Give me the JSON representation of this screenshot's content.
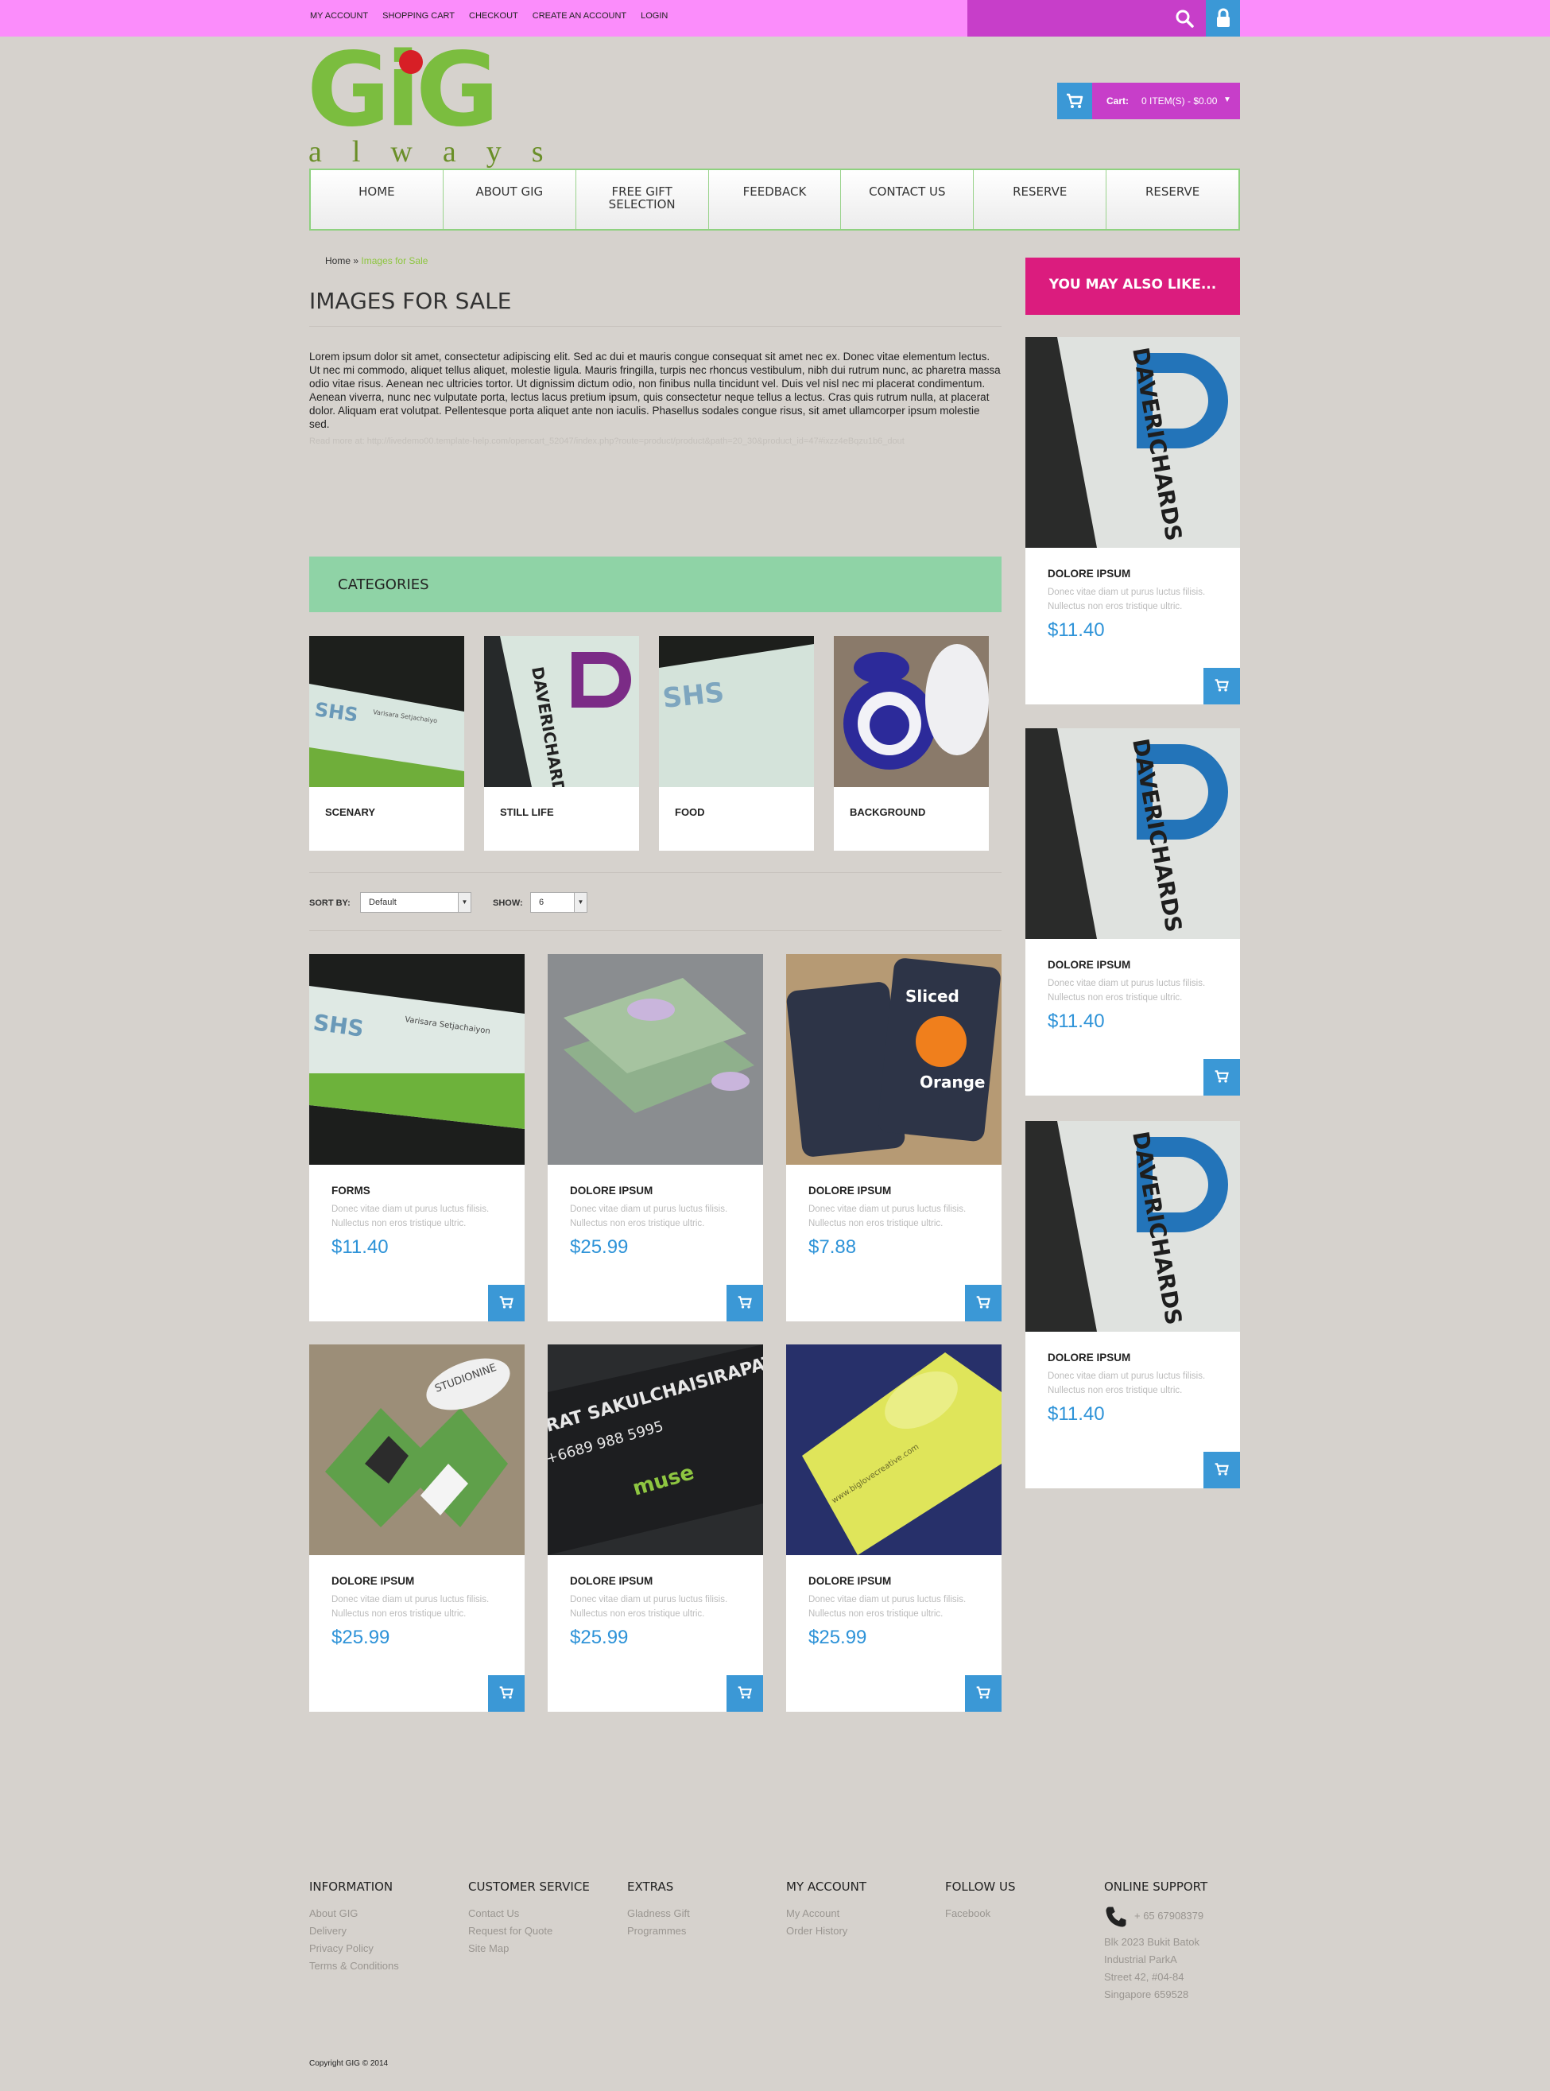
{
  "topbar": {
    "links": [
      "MY ACCOUNT",
      "SHOPPING CART",
      "CHECKOUT",
      "CREATE AN ACCOUNT",
      "LOGIN"
    ]
  },
  "logo": {
    "main": "GiG",
    "sub": "always"
  },
  "cart": {
    "label": "Cart:",
    "value": "0 ITEM(S) - $0.00"
  },
  "nav": [
    "HOME",
    "ABOUT GIG",
    "FREE GIFT SELECTION",
    "FEEDBACK",
    "CONTACT US",
    "RESERVE",
    "RESERVE"
  ],
  "breadcrumb": {
    "home": "Home",
    "sep": "»",
    "current": "Images for Sale"
  },
  "page": {
    "title": "IMAGES FOR SALE",
    "description": "Lorem ipsum dolor sit amet, consectetur adipiscing elit. Sed ac dui et mauris congue consequat sit amet nec ex. Donec vitae elementum lectus. Ut nec mi commodo, aliquet tellus aliquet, molestie ligula. Mauris fringilla, turpis nec rhoncus vestibulum, nibh dui rutrum nunc, ac pharetra massa odio vitae risus. Aenean nec ultricies tortor. Ut dignissim dictum odio, non finibus nulla tincidunt vel. Duis vel nisl nec mi placerat condimentum. Aenean viverra, nunc nec vulputate porta, lectus lacus pretium ipsum, quis consectetur neque tellus a lectus. Cras quis rutrum nulla, at placerat dolor. Aliquam erat volutpat. Pellentesque porta aliquet ante non iaculis. Phasellus sodales congue risus, sit amet ullamcorper ipsum molestie sed.",
    "faint": "Read more at: http://livedemo00.template-help.com/opencart_52047/index.php?route=product/product&path=20_30&product_id=47#ixzz4eBqzu1b6_dout"
  },
  "categories": {
    "heading": "CATEGORIES",
    "items": [
      {
        "name": "SCENARY",
        "image": "shs-card"
      },
      {
        "name": "STILL LIFE",
        "image": "daverichards-card"
      },
      {
        "name": "FOOD",
        "image": "shs-card-plain"
      },
      {
        "name": "BACKGROUND",
        "image": "sticker-card"
      }
    ]
  },
  "sort": {
    "sort_label": "SORT BY:",
    "sort_value": "Default",
    "show_label": "SHOW:",
    "show_value": "6"
  },
  "products": [
    {
      "name": "FORMS",
      "desc": "Donec vitae diam ut purus luctus filisis. Nullectus non eros tristique ultric.",
      "price": "$11.40",
      "image": "shs-green"
    },
    {
      "name": "DOLORE IPSUM",
      "desc": "Donec vitae diam ut purus luctus filisis. Nullectus non eros tristique ultric.",
      "price": "$25.99",
      "image": "pretty-green"
    },
    {
      "name": "DOLORE IPSUM",
      "desc": "Donec vitae diam ut purus luctus filisis. Nullectus non eros tristique ultric.",
      "price": "$7.88",
      "image": "sliced-orange"
    },
    {
      "name": "DOLORE IPSUM",
      "desc": "Donec vitae diam ut purus luctus filisis. Nullectus non eros tristique ultric.",
      "price": "$25.99",
      "image": "studionine"
    },
    {
      "name": "DOLORE IPSUM",
      "desc": "Donec vitae diam ut purus luctus filisis. Nullectus non eros tristique ultric.",
      "price": "$25.99",
      "image": "muse-card"
    },
    {
      "name": "DOLORE IPSUM",
      "desc": "Donec vitae diam ut purus luctus filisis. Nullectus non eros tristique ultric.",
      "price": "$25.99",
      "image": "big-love-card"
    }
  ],
  "sidebar": {
    "heading": "YOU MAY ALSO LIKE...",
    "items": [
      {
        "name": "DOLORE IPSUM",
        "desc": "Donec vitae diam ut purus luctus filisis. Nullectus non eros tristique ultric.",
        "price": "$11.40"
      },
      {
        "name": "DOLORE IPSUM",
        "desc": "Donec vitae diam ut purus luctus filisis. Nullectus non eros tristique ultric.",
        "price": "$11.40"
      },
      {
        "name": "DOLORE IPSUM",
        "desc": "Donec vitae diam ut purus luctus filisis. Nullectus non eros tristique ultric.",
        "price": "$11.40"
      }
    ]
  },
  "footer": {
    "information": {
      "title": "INFORMATION",
      "links": [
        "About GIG",
        "Delivery",
        "Privacy Policy",
        "Terms & Conditions"
      ]
    },
    "customer": {
      "title": "CUSTOMER SERVICE",
      "links": [
        "Contact Us",
        "Request for Quote",
        "Site Map"
      ]
    },
    "extras": {
      "title": "EXTRAS",
      "links": [
        "Gladness Gift",
        "Programmes"
      ]
    },
    "account": {
      "title": "MY ACCOUNT",
      "links": [
        "My Account",
        "Order History"
      ]
    },
    "follow": {
      "title": "FOLLOW US",
      "links": [
        "Facebook"
      ]
    },
    "support": {
      "title": "ONLINE SUPPORT",
      "phone": "+ 65 67908379",
      "address": [
        "Blk 2023 Bukit Batok",
        "Industrial ParkA",
        "Street 42, #04-84",
        "Singapore 659528"
      ]
    },
    "copyright": "Copyright GIG © 2014"
  },
  "colors": {
    "topbar": "#fb8dfb",
    "accent_purple": "#c73ec9",
    "accent_blue": "#3b98d6",
    "accent_pink": "#db1c7e",
    "category_green": "#8fd3a6",
    "logo_green": "#7bbd3f",
    "price_blue": "#2e93d8"
  }
}
